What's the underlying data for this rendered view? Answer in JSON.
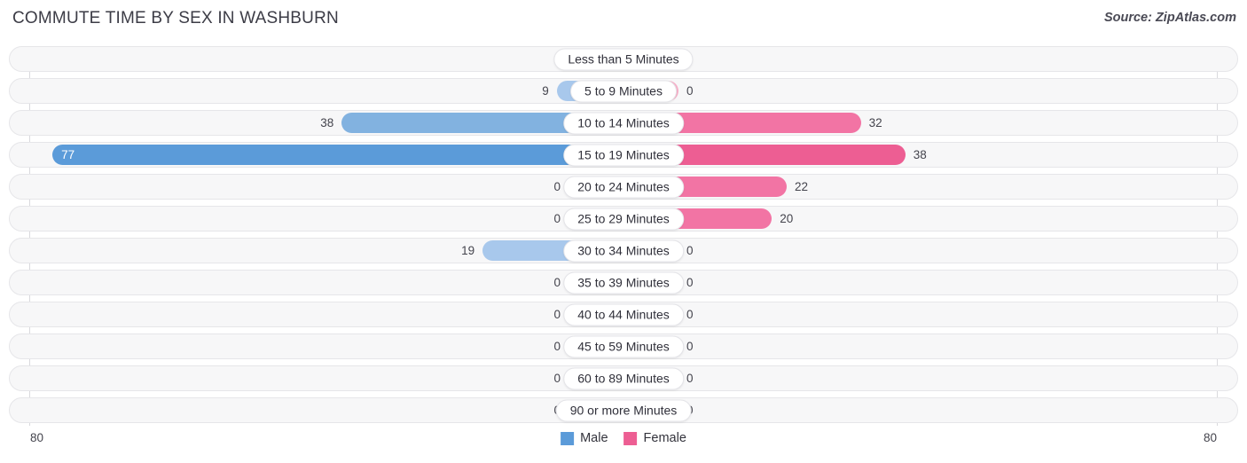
{
  "header": {
    "title": "COMMUTE TIME BY SEX IN WASHBURN",
    "source": "Source: ZipAtlas.com"
  },
  "axis": {
    "left_tick": "80",
    "right_tick": "80"
  },
  "legend": {
    "items": [
      {
        "label": "Male",
        "color": "#5B9BD9"
      },
      {
        "label": "Female",
        "color": "#ED5E93"
      }
    ]
  },
  "colors": {
    "male_strong": "#5B9BD9",
    "male_mid": "#82B2E0",
    "male_light": "#A8C8EC",
    "female_strong": "#ED5E93",
    "female_mid": "#F274A4",
    "female_light": "#F7AFC8",
    "row_background": "#f7f7f8",
    "row_border": "#e6e6e9"
  },
  "chart_data": {
    "type": "bar",
    "title": "COMMUTE TIME BY SEX IN WASHBURN",
    "subtitle": "Source: ZipAtlas.com",
    "orientation": "horizontal-diverging",
    "xlabel": "",
    "ylabel": "",
    "xlim": [
      80,
      80
    ],
    "axis_max": 80,
    "grid": false,
    "legend_position": "bottom-center",
    "categories": [
      "Less than 5 Minutes",
      "5 to 9 Minutes",
      "10 to 14 Minutes",
      "15 to 19 Minutes",
      "20 to 24 Minutes",
      "25 to 29 Minutes",
      "30 to 34 Minutes",
      "35 to 39 Minutes",
      "40 to 44 Minutes",
      "45 to 59 Minutes",
      "60 to 89 Minutes",
      "90 or more Minutes"
    ],
    "series": [
      {
        "name": "Male",
        "color": "#5B9BD9",
        "values": [
          0,
          9,
          38,
          77,
          0,
          0,
          19,
          0,
          0,
          0,
          0,
          0
        ]
      },
      {
        "name": "Female",
        "color": "#ED5E93",
        "values": [
          0,
          0,
          32,
          38,
          22,
          20,
          0,
          0,
          0,
          0,
          0,
          0
        ]
      }
    ]
  }
}
